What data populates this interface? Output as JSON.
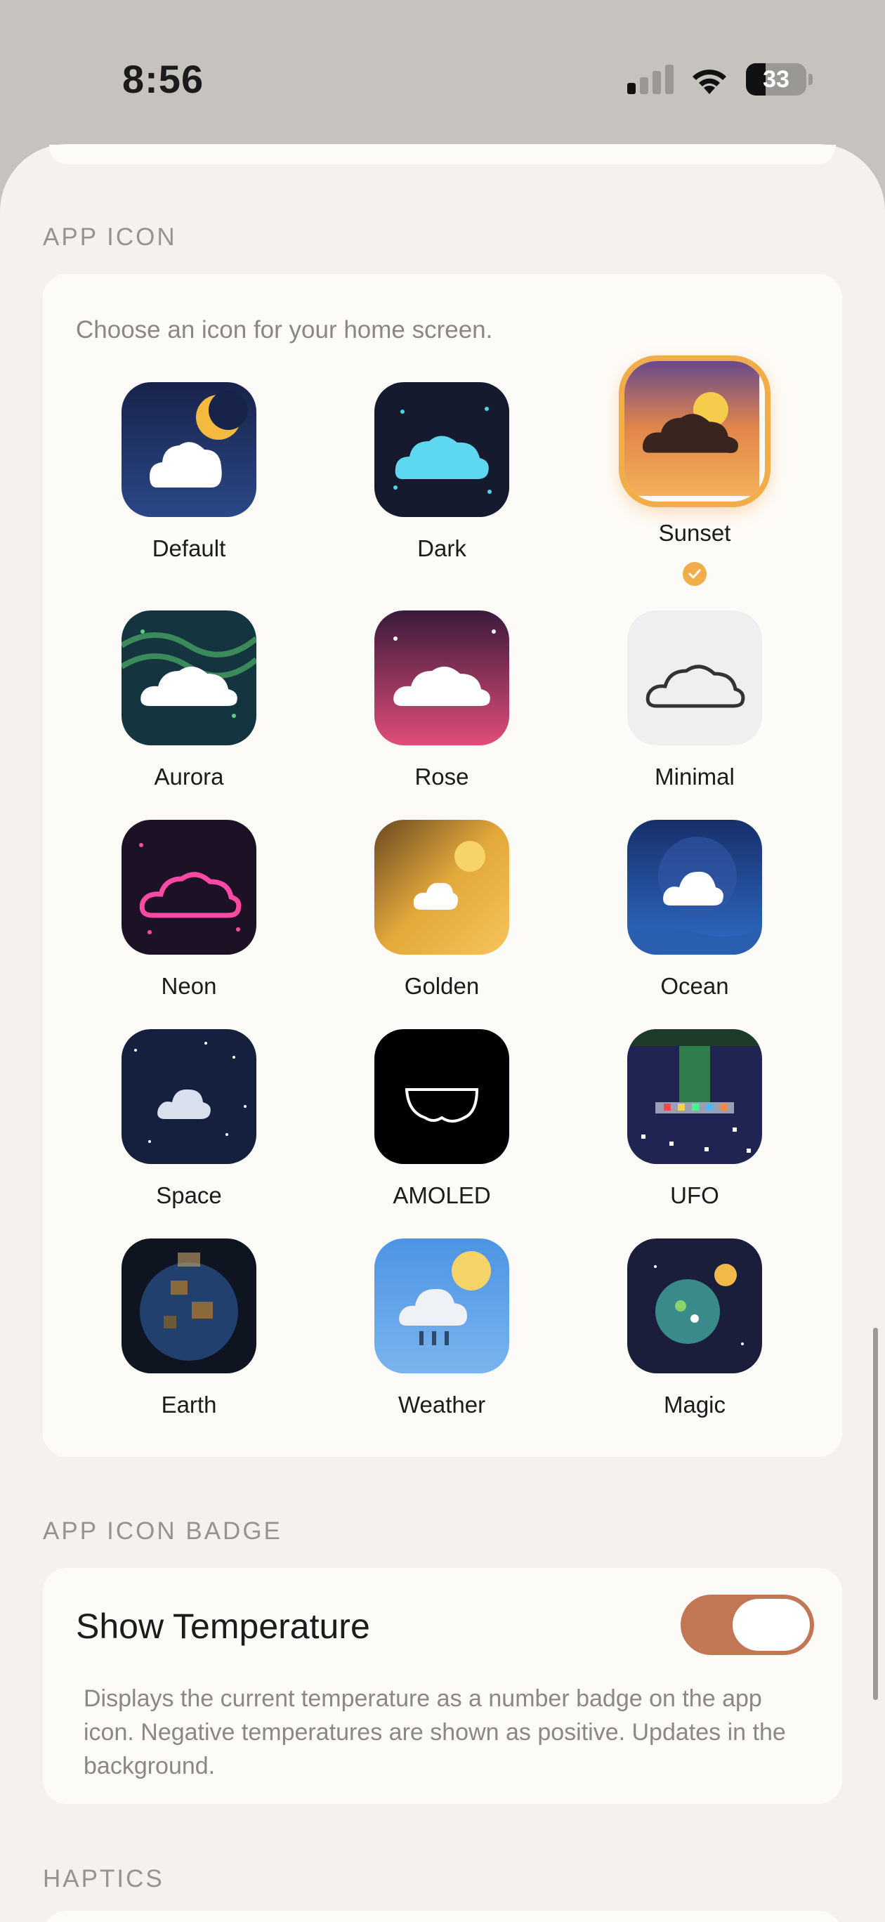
{
  "status_bar": {
    "time": "8:56",
    "battery": "33",
    "battery_level": 0.33
  },
  "app_icon": {
    "header": "APP ICON",
    "hint": "Choose an icon for your home screen.",
    "selected": "Sunset",
    "icons": [
      {
        "label": "Default"
      },
      {
        "label": "Dark"
      },
      {
        "label": "Sunset"
      },
      {
        "label": "Aurora"
      },
      {
        "label": "Rose"
      },
      {
        "label": "Minimal"
      },
      {
        "label": "Neon"
      },
      {
        "label": "Golden"
      },
      {
        "label": "Ocean"
      },
      {
        "label": "Space"
      },
      {
        "label": "AMOLED"
      },
      {
        "label": "UFO"
      },
      {
        "label": "Earth"
      },
      {
        "label": "Weather"
      },
      {
        "label": "Magic"
      }
    ]
  },
  "badge": {
    "header": "APP ICON BADGE",
    "toggle_label": "Show Temperature",
    "toggle_on": true,
    "description": "Displays the current temperature as a number badge on the app icon. Negative temperatures are shown as positive. Updates in the background."
  },
  "haptics": {
    "header": "HAPTICS"
  },
  "colors": {
    "accent": "#c27654",
    "selected_ring": "#f2ad4b",
    "background": "#f5f1ec"
  }
}
